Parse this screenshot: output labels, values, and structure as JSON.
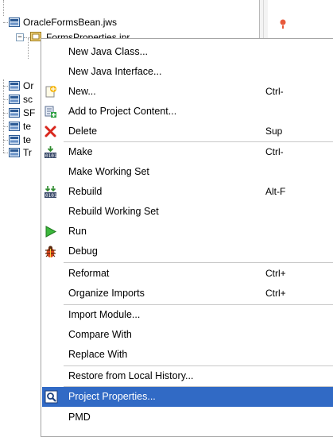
{
  "tree": {
    "root_label": "OracleFormsBean.jws",
    "child_label": "FormsProperties.jpr",
    "partial_rows": [
      "Or",
      "sc",
      "SF",
      "te",
      "te",
      "Tr"
    ]
  },
  "menu": {
    "items": [
      {
        "label": "New Java Class...",
        "shortcut": "",
        "icon": "none"
      },
      {
        "label": "New Java Interface...",
        "shortcut": "",
        "icon": "none"
      },
      {
        "label": "New...",
        "shortcut": "Ctrl-",
        "icon": "new-gallery-icon"
      },
      {
        "label": "Add to Project Content...",
        "shortcut": "",
        "icon": "add-to-project-icon"
      },
      {
        "label": "Delete",
        "shortcut": "Sup",
        "icon": "delete-icon"
      },
      {
        "label": "Make",
        "shortcut": "Ctrl-",
        "icon": "make-icon"
      },
      {
        "label": "Make Working Set",
        "shortcut": "",
        "icon": "none"
      },
      {
        "label": "Rebuild",
        "shortcut": "Alt-F",
        "icon": "rebuild-icon"
      },
      {
        "label": "Rebuild Working Set",
        "shortcut": "",
        "icon": "none"
      },
      {
        "label": "Run",
        "shortcut": "",
        "icon": "run-icon"
      },
      {
        "label": "Debug",
        "shortcut": "",
        "icon": "debug-icon"
      },
      {
        "label": "Reformat",
        "shortcut": "Ctrl+",
        "icon": "none"
      },
      {
        "label": "Organize Imports",
        "shortcut": "Ctrl+",
        "icon": "none"
      },
      {
        "label": "Import Module...",
        "shortcut": "",
        "icon": "none"
      },
      {
        "label": "Compare With",
        "shortcut": "",
        "icon": "none"
      },
      {
        "label": "Replace With",
        "shortcut": "",
        "icon": "none"
      },
      {
        "label": "Restore from Local History...",
        "shortcut": "",
        "icon": "none"
      },
      {
        "label": "Project Properties...",
        "shortcut": "",
        "icon": "project-properties-icon",
        "selected": true
      },
      {
        "label": "PMD",
        "shortcut": "",
        "icon": "none"
      }
    ]
  },
  "colors": {
    "selection": "#316ac5",
    "menu_border": "#a6a6a6",
    "separator": "#c8c8c8"
  }
}
